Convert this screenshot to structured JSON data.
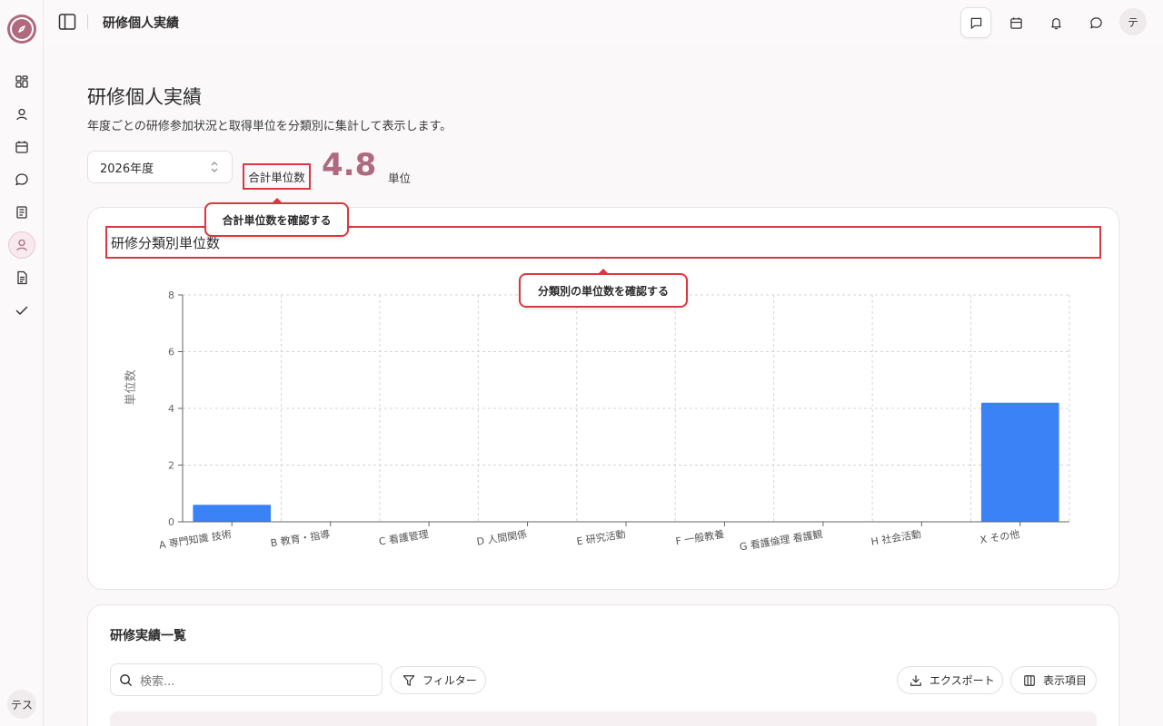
{
  "sidebar": {
    "items": [
      {
        "icon": "grid-icon"
      },
      {
        "icon": "user-icon"
      },
      {
        "icon": "calendar-icon"
      },
      {
        "icon": "chat-icon"
      },
      {
        "icon": "book-icon"
      },
      {
        "icon": "profile-icon",
        "active": true
      },
      {
        "icon": "document-icon"
      },
      {
        "icon": "check-icon"
      }
    ],
    "user_initials": "テス"
  },
  "header": {
    "title": "研修個人実績",
    "avatar_initial": "テ"
  },
  "page": {
    "title": "研修個人実績",
    "subtitle": "年度ごとの研修参加状況と取得単位を分類別に集計して表示します。",
    "year_select": "2026年度",
    "total_label": "合計単位数",
    "total_value": "4.8",
    "total_unit": "単位"
  },
  "tooltips": {
    "total": "合計単位数を確認する",
    "chart": "分類別の単位数を確認する"
  },
  "chart_data": {
    "type": "bar",
    "title": "研修分類別単位数",
    "categories": [
      "A 専門知識 技術",
      "B 教育・指導",
      "C 看護管理",
      "D 人間関係",
      "E 研究活動",
      "F 一般教養",
      "G 看護倫理 看護観",
      "H 社会活動",
      "X その他"
    ],
    "values": [
      0.6,
      0,
      0,
      0,
      0,
      0,
      0,
      0,
      4.2
    ],
    "xlabel": "",
    "ylabel": "単位数",
    "ylim": [
      0,
      8
    ],
    "yticks": [
      0,
      2,
      4,
      6,
      8
    ],
    "grid": true,
    "bar_color": "#3b82f6"
  },
  "list": {
    "title": "研修実績一覧",
    "search_placeholder": "検索...",
    "filter_label": "フィルター",
    "export_label": "エクスポート",
    "columns_label": "表示項目"
  },
  "colors": {
    "accent": "#b06a7f",
    "highlight": "#d9383f",
    "bar": "#3b82f6"
  }
}
